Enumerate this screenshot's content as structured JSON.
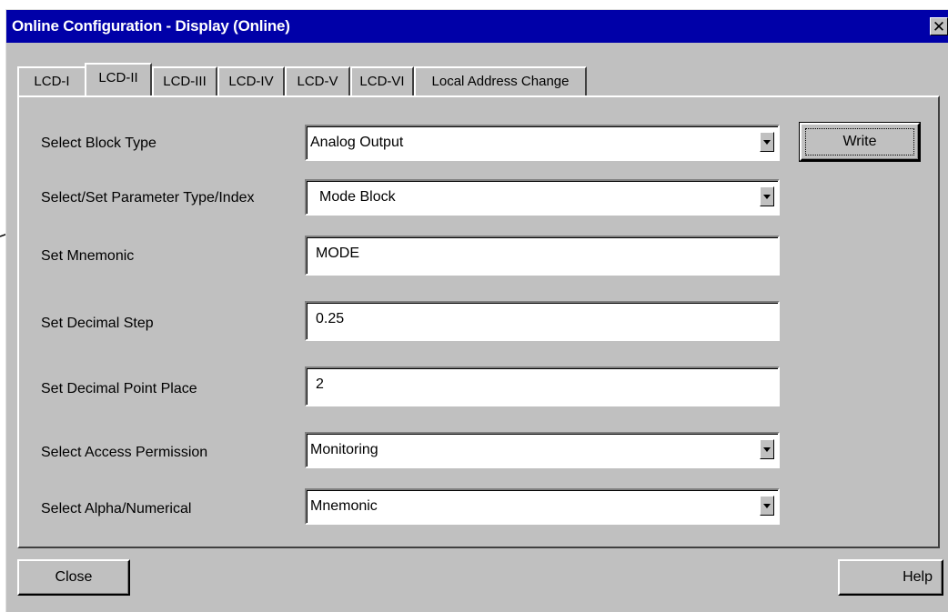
{
  "window": {
    "title": "Online Configuration - Display  (Online)",
    "close_glyph": "✕"
  },
  "tabs": [
    {
      "label": "LCD-I",
      "active": false
    },
    {
      "label": "LCD-II",
      "active": true
    },
    {
      "label": "LCD-III",
      "active": false
    },
    {
      "label": "LCD-IV",
      "active": false
    },
    {
      "label": "LCD-V",
      "active": false
    },
    {
      "label": "LCD-VI",
      "active": false
    },
    {
      "label": "Local Address Change",
      "active": false
    }
  ],
  "form": {
    "block_type_label": "Select Block Type",
    "block_type_value": "Analog Output",
    "param_label": "Select/Set Parameter Type/Index",
    "param_value": "Mode Block",
    "mnemonic_label": "Set Mnemonic",
    "mnemonic_value": "MODE",
    "decimal_step_label": "Set Decimal Step",
    "decimal_step_value": "0.25",
    "decimal_point_label": "Set Decimal Point Place",
    "decimal_point_value": "2",
    "access_label": "Select Access Permission",
    "access_value": "Monitoring",
    "alpha_label": "Select Alpha/Numerical",
    "alpha_value": "Mnemonic"
  },
  "buttons": {
    "write": "Write",
    "close": "Close",
    "help": "Help"
  },
  "colors": {
    "titlebar": "#0000a8",
    "face": "#c0c0c0"
  }
}
